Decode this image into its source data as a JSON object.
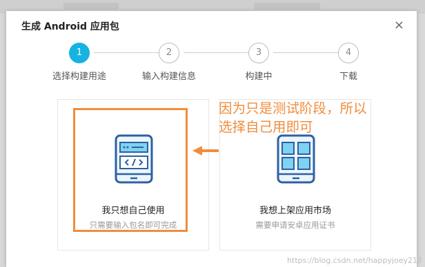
{
  "dialog": {
    "title": "生成 Android 应用包",
    "close_symbol": "×"
  },
  "steps": [
    {
      "number": "1",
      "label": "选择构建用途",
      "state": "active"
    },
    {
      "number": "2",
      "label": "输入构建信息",
      "state": "todo"
    },
    {
      "number": "3",
      "label": "构建中",
      "state": "todo"
    },
    {
      "number": "4",
      "label": "下载",
      "state": "todo"
    }
  ],
  "options": [
    {
      "icon": "code-phone-icon",
      "title": "我只想自己使用",
      "subtitle": "只需要输入包名即可完成"
    },
    {
      "icon": "app-grid-phone-icon",
      "title": "我想上架应用市场",
      "subtitle": "需要申请安卓应用证书"
    }
  ],
  "annotation": {
    "line1": "因为只是测试阶段，所以",
    "line2": "选择自己用即可",
    "color": "#f08c3c"
  },
  "watermark": "https://blog.csdn.net/happyjoey217",
  "colors": {
    "accent": "#17b3e0",
    "annotation": "#f08c3c",
    "icon_blue": "#2f5fa3",
    "icon_light": "#7fd3f0"
  }
}
